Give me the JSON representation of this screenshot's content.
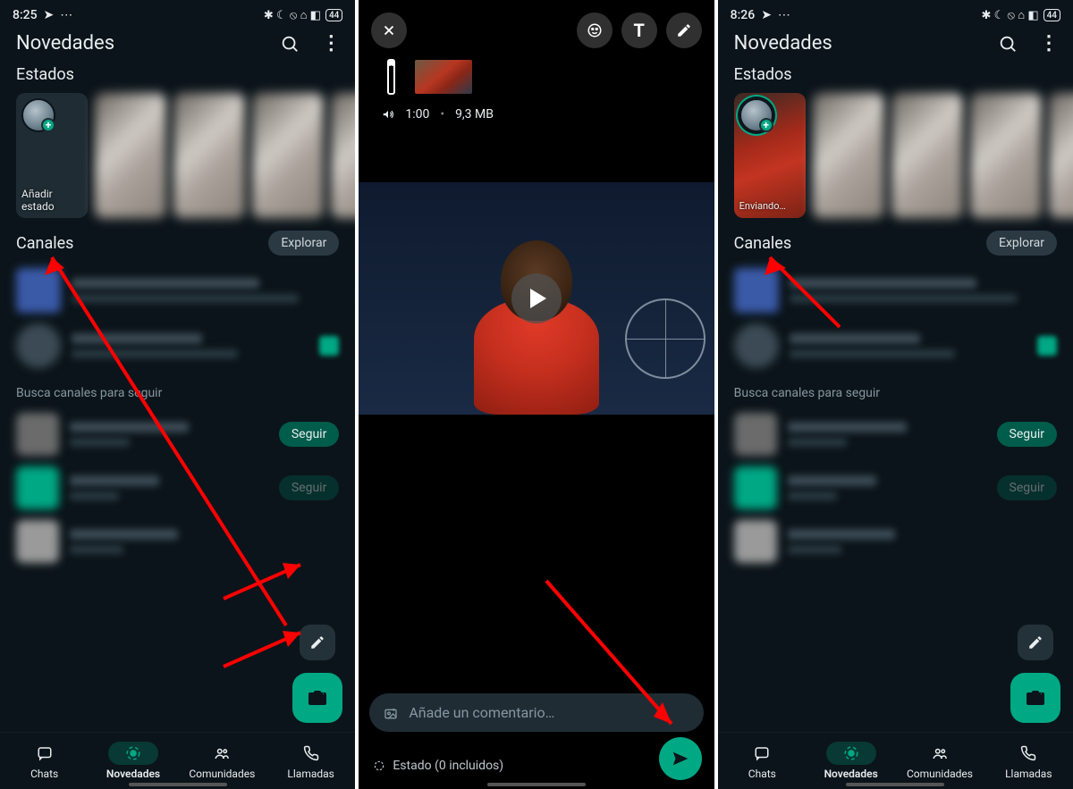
{
  "status_bar": {
    "time_a": "8:25",
    "time_c": "8:26",
    "send_glyph": "➤",
    "more_glyph": "⋯",
    "right_glyphs": "✱  ☾  ⦸  ⌂  ◧",
    "battery": "44"
  },
  "header": {
    "title": "Novedades"
  },
  "sections": {
    "estados": "Estados",
    "canales": "Canales",
    "busca": "Busca canales para seguir"
  },
  "status_card": {
    "add_line1": "Añadir",
    "add_line2": "estado",
    "sending": "Enviando…"
  },
  "buttons": {
    "explorar": "Explorar",
    "seguir": "Seguir"
  },
  "nav": {
    "chats": "Chats",
    "novedades": "Novedades",
    "comunidades": "Comunidades",
    "llamadas": "Llamadas"
  },
  "editor": {
    "duration": "1:00",
    "size": "9,3 MB",
    "caption_placeholder": "Añade un comentario…",
    "destination": "Estado (0 incluidos)"
  }
}
